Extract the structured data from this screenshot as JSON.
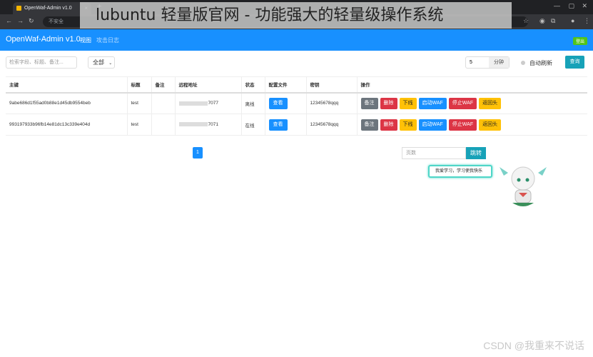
{
  "browser": {
    "tab_title": "OpenWaf-Admin v1.0",
    "new_tab": "+",
    "security_label": "不安全",
    "url_text": "...",
    "overlay_caption": "lubuntu 轻量版官网 - 功能强大的轻量级操作系统"
  },
  "app": {
    "brand": "OpenWaf-Admin v1.0",
    "nav_view": "视图",
    "nav_log": "攻击日志",
    "logout": "登出"
  },
  "toolbar": {
    "search_placeholder": "检索字段、标题、备注...",
    "filter_value": "全部",
    "interval_value": "5",
    "interval_unit": "分钟",
    "auto_refresh": "自动刷新",
    "query": "查询"
  },
  "table": {
    "headers": [
      "主键",
      "标题",
      "备注",
      "远程地址",
      "状态",
      "配置文件",
      "密钥",
      "操作"
    ],
    "rows": [
      {
        "id": "9abe686d1f55ad0b88e1d45db9554beb",
        "title": "test",
        "note": "",
        "addr": "7077",
        "status": "离线",
        "config": "查看",
        "key": "12345678qqq"
      },
      {
        "id": "993197933b96fb14e81dc13c339e404d",
        "title": "test",
        "note": "",
        "addr": "7071",
        "status": "在线",
        "config": "查看",
        "key": "12345678qqq"
      }
    ],
    "actions": [
      "备注",
      "删除",
      "下线",
      "启动WAF",
      "停止WAF",
      "返回头"
    ]
  },
  "pagination": {
    "current": "1",
    "page_placeholder": "页数",
    "jump": "跳转"
  },
  "mascot_bubble": "我爱学习，学习使我快乐",
  "watermark": "CSDN @我重来不说话"
}
